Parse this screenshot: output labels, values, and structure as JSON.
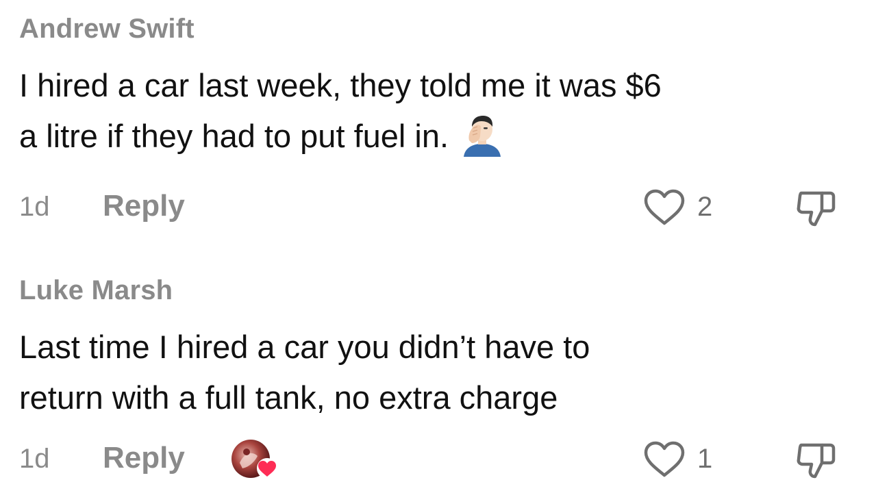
{
  "comments": [
    {
      "author": "Andrew Swift",
      "text_lines": [
        "I hired a car last week, they told me it was $6",
        "a litre if they had to put fuel in."
      ],
      "emoji_icon": "facepalm-icon",
      "time": "1d",
      "reply_label": "Reply",
      "likes": "2"
    },
    {
      "author": "Luke Marsh",
      "text_lines": [
        "Last time I hired a car you didn’t have to",
        "return with a full tank, no extra charge"
      ],
      "time": "1d",
      "reply_label": "Reply",
      "creator_liked_icon": "creator-avatar-heart-icon",
      "likes": "1"
    }
  ],
  "colors": {
    "text": "#111111",
    "muted": "#8a8a8a",
    "count": "#6f6f6f",
    "heart_badge": "#fe2c55"
  }
}
